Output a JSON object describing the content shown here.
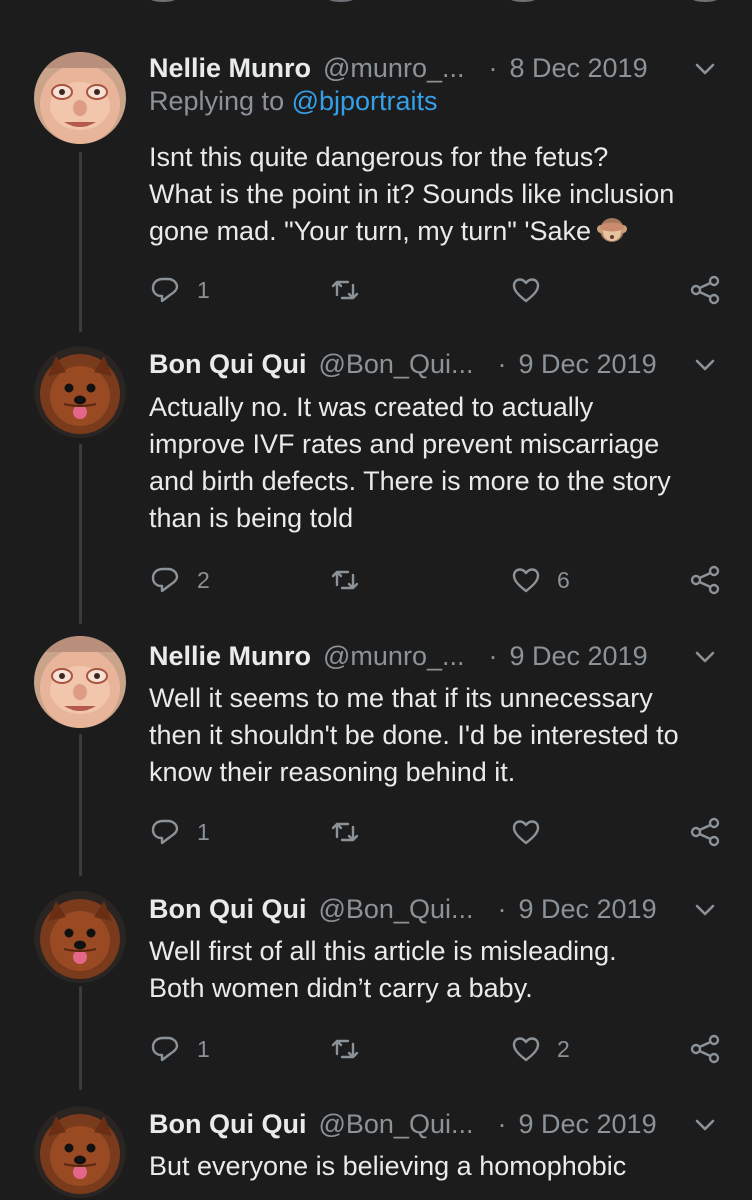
{
  "tweets": [
    {
      "name": "Nellie Munro",
      "handle": "@munro_...",
      "date": "9 Dec 2019"
    }
  ],
  "thread": [
    {
      "name": "Nellie Munro",
      "handle": "@munro_...",
      "date": "8 Dec 2019",
      "replying_prefix": "Replying to ",
      "replying_to": "@bjportraits",
      "text_lines": [
        "Isnt this quite dangerous for the fetus?",
        "What is the point in it? Sounds like inclusion",
        "gone mad. \"Your turn, my turn\" 'Sake"
      ],
      "emoji": "see-no-evil-monkey",
      "replies": "1",
      "retweets": "",
      "likes": ""
    },
    {
      "name": "Bon Qui Qui",
      "handle": "@Bon_Qui...",
      "date": "9 Dec 2019",
      "text_lines": [
        "Actually no. It was created to actually",
        "improve IVF rates and prevent miscarriage",
        "and birth defects. There is more to the story",
        "than is being told"
      ],
      "replies": "2",
      "retweets": "",
      "likes": "6"
    },
    {
      "name": "Nellie Munro",
      "handle": "@munro_...",
      "date": "9 Dec 2019",
      "text_lines": [
        "Well it seems to me that if its unnecessary",
        "then it shouldn't be done. I'd be interested to",
        "know their reasoning behind it."
      ],
      "replies": "1",
      "retweets": "",
      "likes": ""
    },
    {
      "name": "Bon Qui Qui",
      "handle": "@Bon_Qui...",
      "date": "9 Dec 2019",
      "text_lines": [
        "Well first of all this article is misleading.",
        "Both women didn’t carry a baby."
      ],
      "replies": "1",
      "retweets": "",
      "likes": "2"
    },
    {
      "name": "Bon Qui Qui",
      "handle": "@Bon_Qui...",
      "date": "9 Dec 2019",
      "text_lines": [
        "But everyone is believing a homophobic"
      ]
    }
  ],
  "icons": [
    "reply-icon",
    "retweet-icon",
    "like-icon",
    "share-icon",
    "chevron-down-icon"
  ],
  "colors": {
    "background": "#1c1c1c",
    "text": "#e8eaeb",
    "secondary": "#8b9298",
    "link": "#34a0e8",
    "thread_line": "#3a3d40"
  }
}
